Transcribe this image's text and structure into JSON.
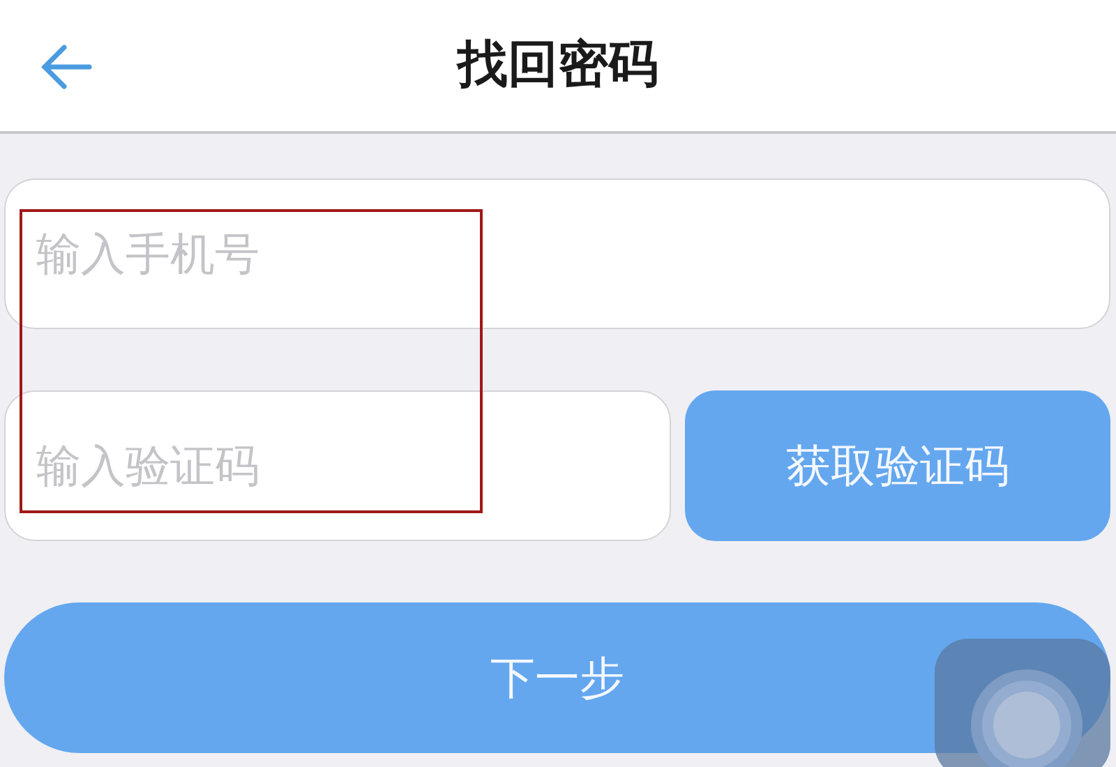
{
  "header": {
    "title": "找回密码"
  },
  "phone_field": {
    "placeholder": "输入手机号"
  },
  "code_field": {
    "placeholder": "输入验证码"
  },
  "get_code_button": {
    "label": "获取验证码"
  },
  "next_button": {
    "label": "下一步"
  }
}
